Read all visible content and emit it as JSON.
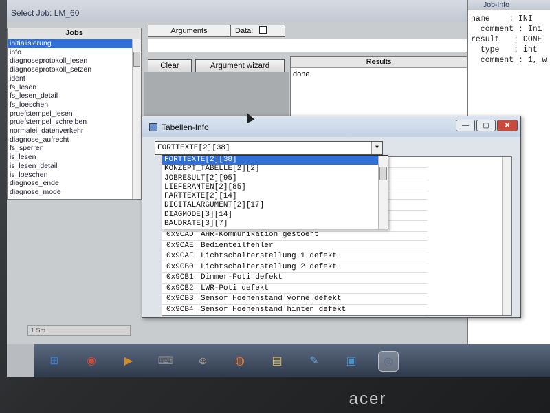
{
  "job_window": {
    "title": "Select Job: LM_60",
    "jobs_header": "Jobs",
    "jobs": [
      "initialisierung",
      "info",
      "diagnoseprotokoll_lesen",
      "diagnoseprotokoll_setzen",
      "ident",
      "fs_lesen",
      "fs_lesen_detail",
      "fs_loeschen",
      "pruefstempel_lesen",
      "pruefstempel_schreiben",
      "normalei_datenverkehr",
      "diagnose_aufrecht",
      "fs_sperren",
      "is_lesen",
      "is_lesen_detail",
      "is_loeschen",
      "diagnose_ende",
      "diagnose_mode"
    ],
    "selected_job_index": 0,
    "arguments_label": "Arguments",
    "data_label": "Data:",
    "clear_button": "Clear",
    "wizard_button": "Argument wizard",
    "results_header": "Results",
    "results_value": "done",
    "status_text": "1 Sm"
  },
  "job_info": {
    "title": "Job-Info",
    "lines": [
      "name    : INI",
      "  comment : Ini",
      "",
      "result   : DONE",
      "  type   : int",
      "  comment : 1, w"
    ]
  },
  "dialog": {
    "title": "Tabellen-Info",
    "minimize": "—",
    "maximize": "▢",
    "close": "✕",
    "combo_value": "FORTTEXTE[2][38]",
    "dropdown_items": [
      "FORTTEXTE[2][38]",
      "KONZEPT_TABELLE[2][2]",
      "JOBRESULT[2][95]",
      "LIEFERANTEN[2][85]",
      "FARTTEXTE[2][14]",
      "DIGITALARGUMENT[2][17]",
      "DIAGMODE[3][14]",
      "BAUDRATE[3][7]"
    ],
    "selected_item_index": 0,
    "rows": [
      {
        "code": "0x9CAD",
        "text": "AHR-Kommunikation gestoert"
      },
      {
        "code": "0x9CAE",
        "text": "Bedienteilfehler"
      },
      {
        "code": "0x9CAF",
        "text": "Lichtschalterstellung 1 defekt"
      },
      {
        "code": "0x9CB0",
        "text": "Lichtschalterstellung 2 defekt"
      },
      {
        "code": "0x9CB1",
        "text": "Dimmer-Poti defekt"
      },
      {
        "code": "0x9CB2",
        "text": "LWR-Poti defekt"
      },
      {
        "code": "0x9CB3",
        "text": "Sensor Hoehenstand vorne defekt"
      },
      {
        "code": "0x9CB4",
        "text": "Sensor Hoehenstand hinten defekt"
      }
    ]
  },
  "taskbar": {
    "icons": [
      "windows-start",
      "chrome",
      "media-player",
      "keyboard",
      "user-tool",
      "firefox",
      "folder",
      "paint",
      "remote-desktop",
      "eye-app"
    ],
    "active_index": 9
  },
  "brand": "acer"
}
